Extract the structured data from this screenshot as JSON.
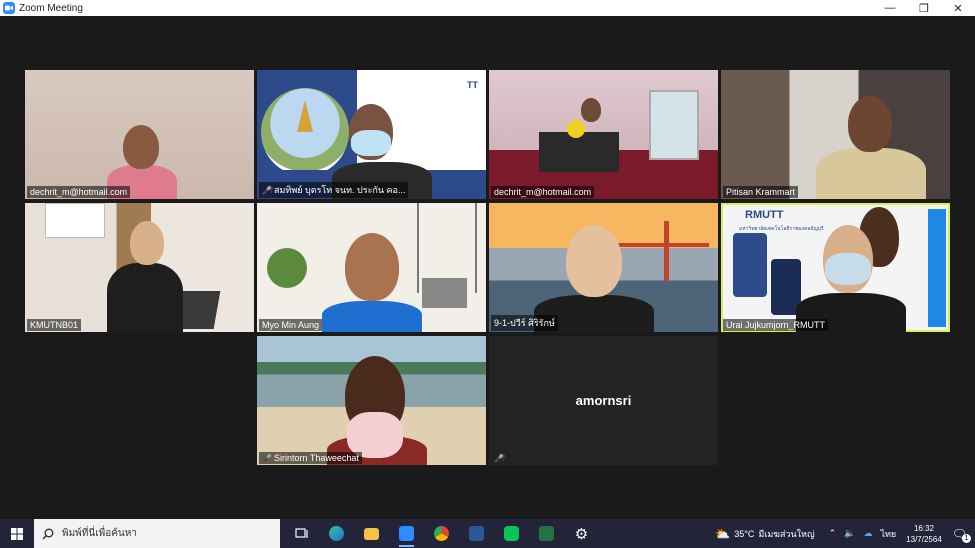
{
  "window": {
    "title": "Zoom Meeting",
    "minimize": "—",
    "restore": "❐",
    "close": "✕"
  },
  "participants": [
    {
      "name": "dechrit_m@hotmail.com",
      "muted": false
    },
    {
      "name": "สมทิพย์ บุตรโท จนท. ประกัน คอ...",
      "muted": true
    },
    {
      "name": "dechrit_m@hotmail.com",
      "muted": false
    },
    {
      "name": "Pitisan Krammart",
      "muted": false
    },
    {
      "name": "KMUTNB01",
      "muted": false
    },
    {
      "name": "Myo Min Aung",
      "muted": false
    },
    {
      "name": "9-1-ปวีร์ ศิริรักษ์",
      "muted": false
    },
    {
      "name": "Urai Jujkumjorn_RMUTT",
      "muted": false,
      "active": true
    },
    {
      "name": "Sirintorn Thaweechat",
      "muted": true
    },
    {
      "name": "",
      "muted": true,
      "display_name": "amornsri"
    }
  ],
  "tile_texts": {
    "logo_tile2": "TT",
    "logo_tile8": "RMUTT",
    "caption_tile8": "มหาวิทยาลัยเทคโนโลยีราชมงคลธัญบุรี"
  },
  "taskbar": {
    "search_placeholder": "พิมพ์ที่นี่เพื่อค้นหา",
    "weather": "35°C",
    "weather_text": "มีเมฆส่วนใหญ่",
    "language": "ไทย",
    "time": "16:32",
    "date": "13/7/2564",
    "notifications": "1"
  },
  "colors": {
    "accent": "#2d8cff",
    "active_speaker": "#d7f24a",
    "muted": "#e02828",
    "taskbar": "#23233a"
  }
}
